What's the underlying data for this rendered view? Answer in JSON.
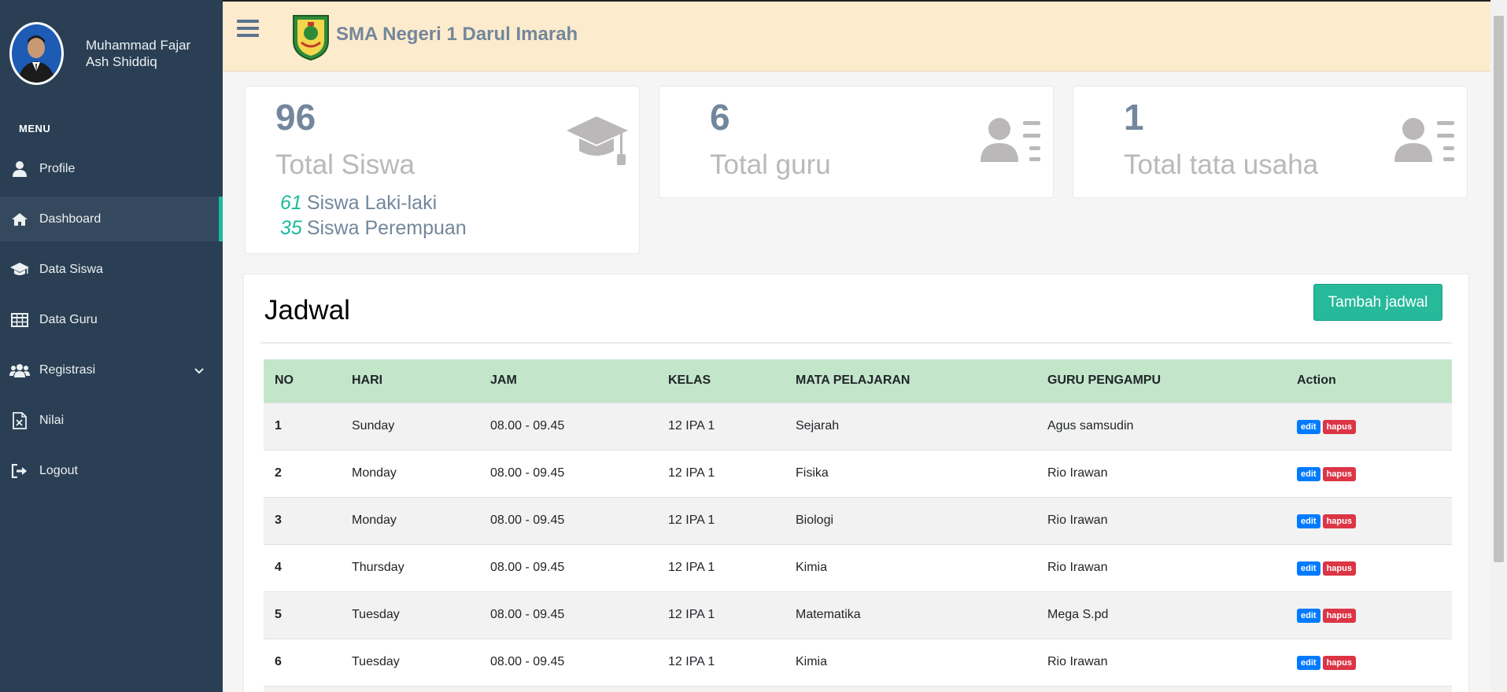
{
  "user": {
    "name": "Muhammad Fajar Ash Shiddiq"
  },
  "sidebar": {
    "menu_title": "MENU",
    "items": [
      {
        "label": "Profile",
        "icon": "user-icon"
      },
      {
        "label": "Dashboard",
        "icon": "home-icon",
        "active": true
      },
      {
        "label": "Data Siswa",
        "icon": "graduation-cap-icon"
      },
      {
        "label": "Data Guru",
        "icon": "table-icon"
      },
      {
        "label": "Registrasi",
        "icon": "users-icon"
      },
      {
        "label": "Nilai",
        "icon": "excel-file-icon"
      },
      {
        "label": "Logout",
        "icon": "sign-out-icon"
      }
    ]
  },
  "header": {
    "school_name": "SMA Negeri 1 Darul Imarah"
  },
  "stats": {
    "siswa": {
      "count": "96",
      "label": "Total Siswa",
      "laki_count": "61",
      "laki_label": "Siswa Laki-laki",
      "perempuan_count": "35",
      "perempuan_label": "Siswa Perempuan"
    },
    "guru": {
      "count": "6",
      "label": "Total guru"
    },
    "tata_usaha": {
      "count": "1",
      "label": "Total tata usaha"
    }
  },
  "jadwal": {
    "title": "Jadwal",
    "add_button": "Tambah jadwal",
    "columns": [
      "NO",
      "HARI",
      "JAM",
      "KELAS",
      "MATA PELAJARAN",
      "GURU PENGAMPU",
      "Action"
    ],
    "edit_label": "edit",
    "delete_label": "hapus",
    "rows": [
      {
        "no": "1",
        "hari": "Sunday",
        "jam": "08.00 - 09.45",
        "kelas": "12 IPA 1",
        "mapel": "Sejarah",
        "guru": "Agus samsudin"
      },
      {
        "no": "2",
        "hari": "Monday",
        "jam": "08.00 - 09.45",
        "kelas": "12 IPA 1",
        "mapel": "Fisika",
        "guru": "Rio Irawan"
      },
      {
        "no": "3",
        "hari": "Monday",
        "jam": "08.00 - 09.45",
        "kelas": "12 IPA 1",
        "mapel": "Biologi",
        "guru": "Rio Irawan"
      },
      {
        "no": "4",
        "hari": "Thursday",
        "jam": "08.00 - 09.45",
        "kelas": "12 IPA 1",
        "mapel": "Kimia",
        "guru": "Rio Irawan"
      },
      {
        "no": "5",
        "hari": "Tuesday",
        "jam": "08.00 - 09.45",
        "kelas": "12 IPA 1",
        "mapel": "Matematika",
        "guru": "Mega S.pd"
      },
      {
        "no": "6",
        "hari": "Tuesday",
        "jam": "08.00 - 09.45",
        "kelas": "12 IPA 1",
        "mapel": "Kimia",
        "guru": "Rio Irawan"
      }
    ]
  },
  "colors": {
    "sidebar": "#2a3f54",
    "header": "#fdebcd",
    "accent": "#1abb9c",
    "button": "#26b99a",
    "table_header": "#c3e6cb"
  }
}
